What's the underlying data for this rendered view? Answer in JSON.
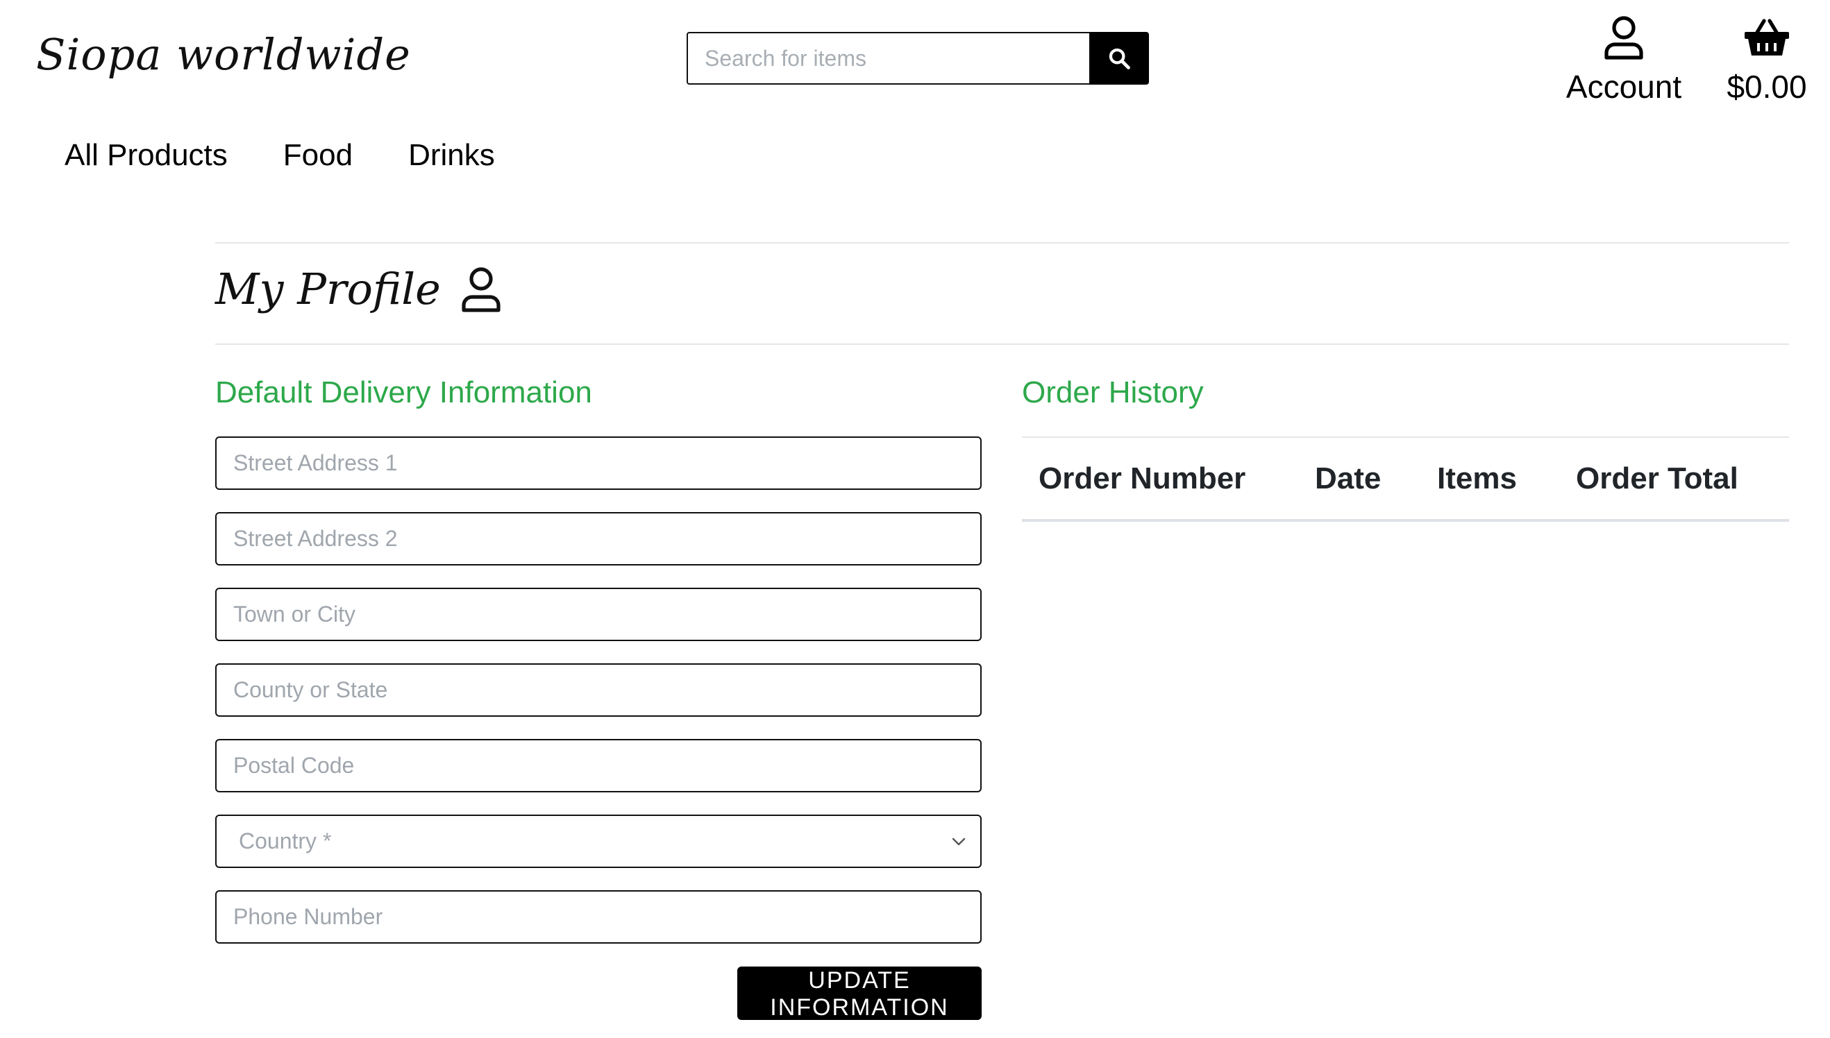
{
  "header": {
    "logo_text": "Siopa worldwide",
    "search_placeholder": "Search for items",
    "account_label": "Account",
    "basket_total": "$0.00"
  },
  "nav": {
    "items": [
      "All Products",
      "Food",
      "Drinks"
    ]
  },
  "profile": {
    "title": "My Profile"
  },
  "delivery": {
    "heading": "Default Delivery Information",
    "fields": {
      "street1": "Street Address 1",
      "street2": "Street Address 2",
      "town": "Town or City",
      "county": "County or State",
      "postcode": "Postal Code",
      "country": "Country *",
      "phone": "Phone Number"
    },
    "submit_label": "UPDATE INFORMATION"
  },
  "orders": {
    "heading": "Order History",
    "columns": [
      "Order Number",
      "Date",
      "Items",
      "Order Total"
    ],
    "rows": []
  },
  "colors": {
    "accent_green": "#2da84a",
    "button_black": "#000000"
  },
  "icons": {
    "search": "search-icon",
    "account": "user-icon",
    "basket": "basket-icon",
    "profile": "user-icon"
  }
}
